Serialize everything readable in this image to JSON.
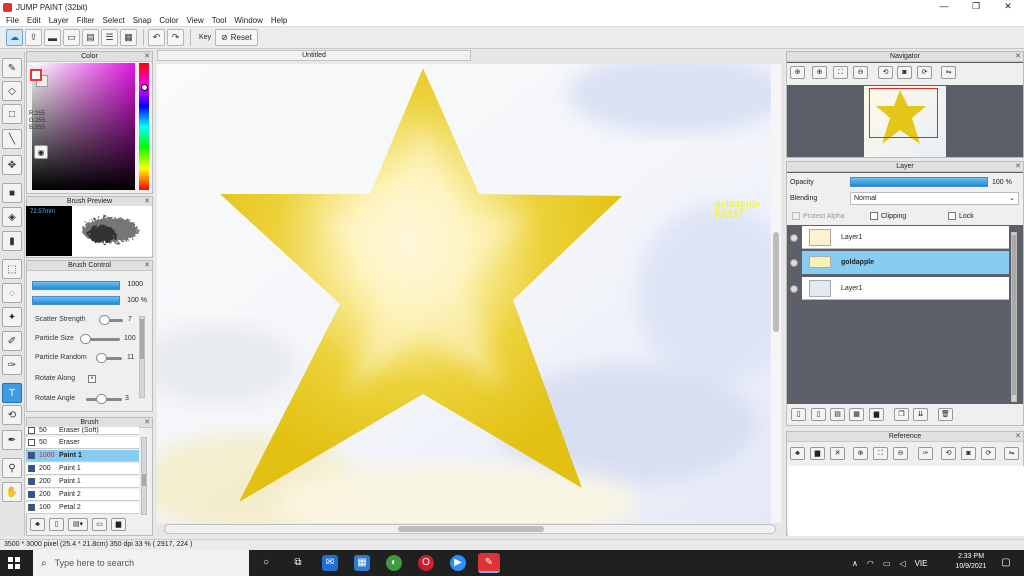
{
  "app": {
    "title": "JUMP PAINT (32bit)",
    "window_controls": [
      "—",
      "❐",
      "✕"
    ]
  },
  "menu": [
    "File",
    "Edit",
    "Layer",
    "Filter",
    "Select",
    "Snap",
    "Color",
    "View",
    "Tool",
    "Window",
    "Help"
  ],
  "toolbar": {
    "key_label": "Key",
    "reset_label": "Reset",
    "reset_icon": "⊘"
  },
  "color_panel": {
    "title": "Color",
    "r": "R:255",
    "g": "G:255",
    "b": "B:255",
    "close": "✕"
  },
  "brush_preview": {
    "title": "Brush Preview",
    "size": "72.57mm",
    "close": "✕"
  },
  "brush_control": {
    "title": "Brush Control",
    "size_value": "1000",
    "opacity_value": "100 %",
    "rows": [
      {
        "label": "Scatter Strength",
        "value": "7"
      },
      {
        "label": "Particle Size",
        "value": "100"
      },
      {
        "label": "Particle Random",
        "value": "11"
      },
      {
        "label": "Rotate Along",
        "value": ""
      },
      {
        "label": "Rotate Angle",
        "value": "3"
      }
    ],
    "close": "✕"
  },
  "brush_list": {
    "title": "Brush",
    "items": [
      {
        "size": "50",
        "name": "Eraser (Soft)",
        "color": "#ffffff"
      },
      {
        "size": "50",
        "name": "Eraser",
        "color": "#ffffff"
      },
      {
        "size": "1000",
        "name": "Paint 1",
        "color": "#1f55c9"
      },
      {
        "size": "200",
        "name": "Paint 1",
        "color": "#1f55c9"
      },
      {
        "size": "200",
        "name": "Paint 1",
        "color": "#1f55c9"
      },
      {
        "size": "200",
        "name": "Paint 2",
        "color": "#1f55c9"
      },
      {
        "size": "100",
        "name": "Petal 2",
        "color": "#1f55c9"
      }
    ],
    "close": "✕"
  },
  "document": {
    "tab_title": "Untitled",
    "canvas_text_line1": "goldapple",
    "canvas_text_line2": "hd247"
  },
  "navigator": {
    "title": "Navigator",
    "close": "✕"
  },
  "layer_panel": {
    "title": "Layer",
    "opacity_label": "Opacity",
    "opacity_value": "100 %",
    "blending_label": "Blending",
    "blending_value": "Normal",
    "protect_alpha": "Protect Alpha",
    "clipping": "Clipping",
    "lock": "Lock",
    "layers": [
      "Layer1",
      "goldapple",
      "Layer1"
    ],
    "close": "✕"
  },
  "reference": {
    "title": "Reference",
    "close": "✕"
  },
  "status": {
    "text": "3500 * 3000 pixel  (25.4 * 21.8cm)  350 dpi  33 %  ( 2917, 224 )"
  },
  "taskbar": {
    "search_placeholder": "Type here to search",
    "time": "2:33 PM",
    "date": "10/9/2021",
    "lang": "VIE"
  },
  "colors": {
    "accent": "#3f9be4",
    "selection": "#87cdf3",
    "star": "#e8c820"
  }
}
